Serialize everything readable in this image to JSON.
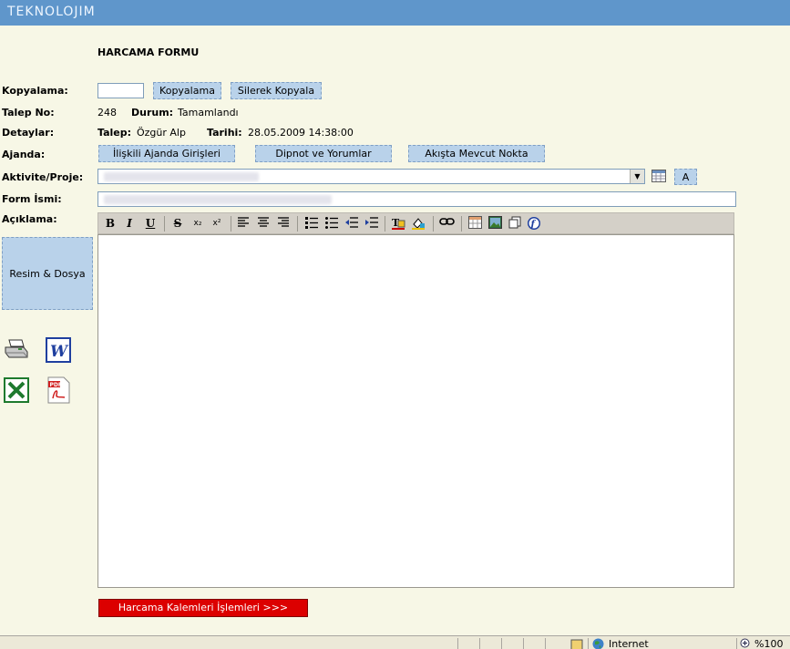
{
  "app": {
    "logo": "TEKNOLOJIM"
  },
  "form": {
    "title": "HARCAMA FORMU",
    "copy_label": "Kopyalama:",
    "copy_button": "Kopyalama",
    "copy_delete_button": "Silerek Kopyala",
    "request_no_label": "Talep No:",
    "request_no": "248",
    "status_label": "Durum:",
    "status": "Tamamlandı",
    "details_label": "Detaylar:",
    "requester_label": "Talep:",
    "requester": "Özgür Alp",
    "date_label": "Tarihi:",
    "date": "28.05.2009 14:38:00",
    "agenda_label": "Ajanda:",
    "agenda_buttons": [
      "İlişkili Ajanda Girişleri",
      "Dipnot ve Yorumlar",
      "Akışta Mevcut Nokta"
    ],
    "activity_label": "Aktivite/Proje:",
    "activity_a_button": "A",
    "form_name_label": "Form İsmi:",
    "description_label": "Açıklama:",
    "files_button": "Resim & Dosya",
    "submit_button": "Harcama Kalemleri İşlemleri >>>"
  },
  "toolbar": {
    "bold": "B",
    "italic": "I",
    "underline": "U",
    "strike": "S",
    "subscript": "x₂",
    "superscript": "x²"
  },
  "statusbar": {
    "zone": "Internet",
    "zoom": "%100"
  },
  "icons": {
    "print": "printer-icon",
    "word": "word-icon",
    "excel": "excel-icon",
    "pdf": "pdf-icon"
  },
  "colors": {
    "header": "#5f96cb",
    "button": "#b9d2ea",
    "submit": "#dc0000",
    "background": "#f7f7e6"
  }
}
